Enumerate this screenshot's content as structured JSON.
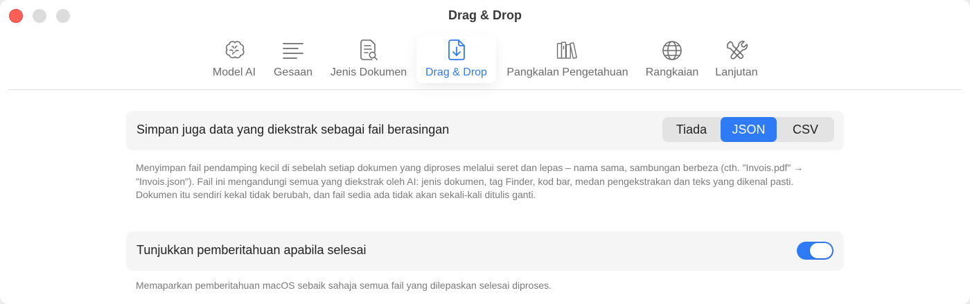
{
  "window": {
    "title": "Drag & Drop",
    "accent_color": "#2f7bf5"
  },
  "toolbar": {
    "tabs": [
      {
        "label": "Model AI",
        "icon": "brain-icon",
        "active": false
      },
      {
        "label": "Gesaan",
        "icon": "text-lines-icon",
        "active": false
      },
      {
        "label": "Jenis Dokumen",
        "icon": "document-search-icon",
        "active": false
      },
      {
        "label": "Drag & Drop",
        "icon": "document-download-icon",
        "active": true
      },
      {
        "label": "Pangkalan Pengetahuan",
        "icon": "books-icon",
        "active": false
      },
      {
        "label": "Rangkaian",
        "icon": "globe-icon",
        "active": false
      },
      {
        "label": "Lanjutan",
        "icon": "tools-icon",
        "active": false
      }
    ]
  },
  "settings": {
    "sidecar": {
      "label": "Simpan juga data yang diekstrak sebagai fail berasingan",
      "options": [
        "Tiada",
        "JSON",
        "CSV"
      ],
      "selected": "JSON",
      "description": "Menyimpan fail pendamping kecil di sebelah setiap dokumen yang diproses melalui seret dan lepas – nama sama, sambungan berbeza (cth. \"Invois.pdf\" → \"Invois.json\"). Fail ini mengandungi semua yang diekstrak oleh AI: jenis dokumen, tag Finder, kod bar, medan pengekstrakan dan teks yang dikenal pasti. Dokumen itu sendiri kekal tidak berubah, dan fail sedia ada tidak akan sekali-kali ditulis ganti."
    },
    "notification": {
      "label": "Tunjukkan pemberitahuan apabila selesai",
      "enabled": true,
      "description": "Memaparkan pemberitahuan macOS sebaik sahaja semua fail yang dilepaskan selesai diproses."
    }
  }
}
